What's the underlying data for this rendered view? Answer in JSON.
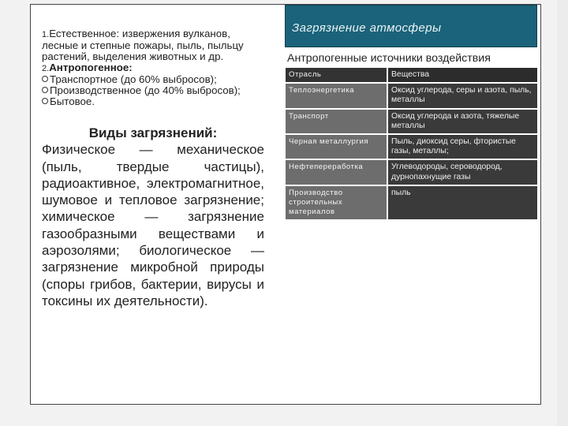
{
  "left": {
    "intro": {
      "n1": "1.",
      "natural_label": "Естественное:",
      "natural_text": " извержения вулканов, лесные и степные пожары, пыль, пыльцу растений, выделения животных и др.",
      "n2": "2.",
      "anthro_label": "Антропогенное:",
      "bullets": [
        "Транспортное (до 60% выбросов);",
        "Производственное (до 40% выбросов);",
        "Бытовое."
      ]
    },
    "types_title": "Виды загрязнений:",
    "types_body": "Физическое — механическое (пыль, твердые частицы), радиоактивное, электромагнитное, шумовое и тепловое загрязнение; химическое — загрязнение газообразными веществами и аэрозолями; биологическое — загрязнение микробной природы (споры грибов, бактерии, вирусы и токсины их деятельности)."
  },
  "right": {
    "title": "Загрязнение атмосферы",
    "subtitle": "Антропогенные источники воздействия",
    "table": {
      "header": {
        "left": "Отрасль",
        "right": "Вещества"
      },
      "rows": [
        {
          "left": "Теплоэнергетика",
          "right": "Оксид углерода, серы и азота, пыль, металлы"
        },
        {
          "left": "Транспорт",
          "right": "Оксид углерода и азота, тяжелые металлы"
        },
        {
          "left": "Черная металлургия",
          "right": "Пыль, диоксид серы, фтористые газы, металлы;"
        },
        {
          "left": "Нефтепереработка",
          "right": "Углеводороды, сероводород, дурнопахнущие газы"
        },
        {
          "left": "Производство строительных материалов",
          "right": "пыль"
        }
      ]
    }
  },
  "colors": {
    "title_bg": "#1b637a",
    "table_dark": "#3a3a3a",
    "table_grey": "#6d6d6d"
  }
}
